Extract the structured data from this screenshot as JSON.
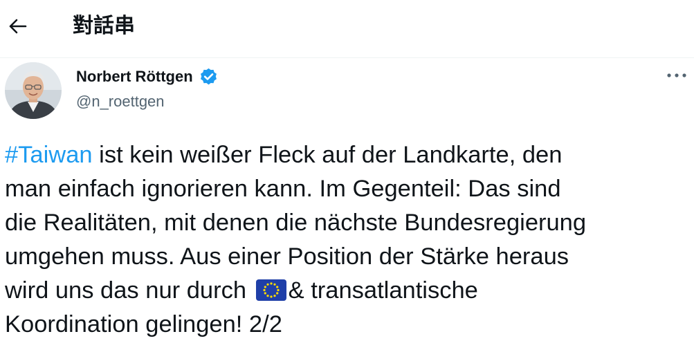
{
  "header": {
    "title": "對話串",
    "back_icon": "arrow-left-icon"
  },
  "tweet": {
    "author": {
      "name": "Norbert Röttgen",
      "handle": "@n_roettgen",
      "verified": true,
      "verified_color": "#1d9bf0"
    },
    "more_icon": "more-horizontal-icon",
    "text": {
      "hashtag": "#Taiwan",
      "line1_rest": " ist kein weißer Fleck auf der Landkarte, den",
      "line2": "man einfach ignorieren kann. Im Gegenteil: Das sind",
      "line3": "die Realitäten, mit denen die nächste Bundesregierung",
      "line4": "umgehen muss. Aus einer Position der Stärke heraus",
      "line5_before_flag": "wird uns das nur durch ",
      "flag_emoji": "eu-flag-icon",
      "line5_after_flag": "& transatlantische",
      "line6": "Koordination gelingen! 2/2"
    }
  },
  "colors": {
    "text": "#0f1419",
    "secondary": "#536471",
    "link": "#1d9bf0",
    "divider": "#eff3f4"
  }
}
